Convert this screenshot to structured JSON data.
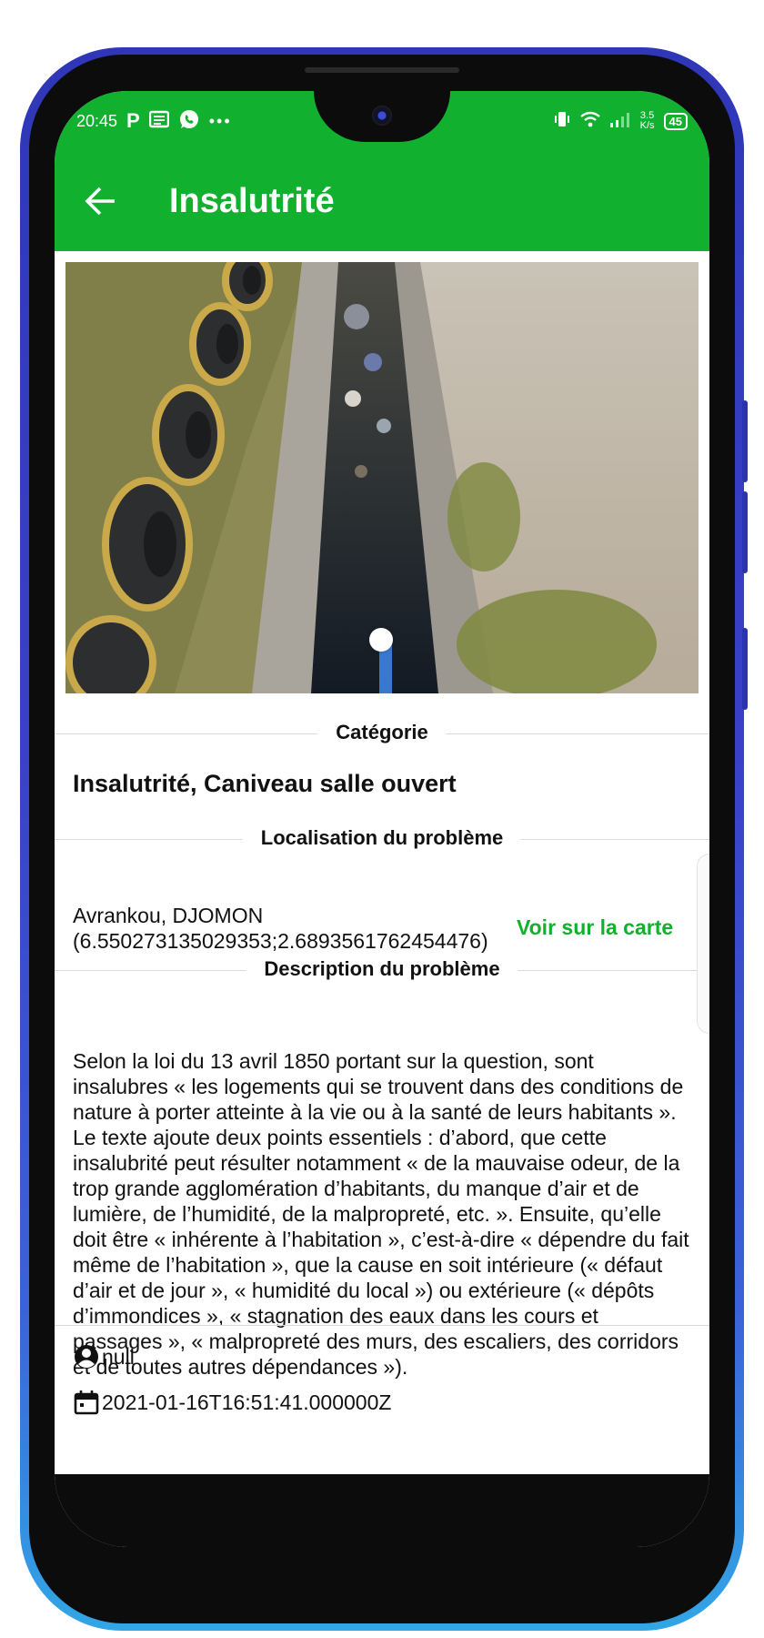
{
  "status_bar": {
    "time": "20:45",
    "app_icons": [
      "P",
      "news-icon",
      "whatsapp-icon"
    ],
    "more": "•••",
    "net_speed_top": "3.5",
    "net_speed_bottom": "K/s",
    "battery": "45"
  },
  "app_bar": {
    "title": "Insalutrité"
  },
  "sections": {
    "category": {
      "header": "Catégorie",
      "value": "Insalutrité, Caniveau salle ouvert"
    },
    "location": {
      "header": "Localisation du problème",
      "address": "Avrankou, DJOMON",
      "coordinates": "(6.550273135029353;2.6893561762454476)",
      "map_link": "Voir sur la carte"
    },
    "description": {
      "header": "Description du problème",
      "text": "Selon la loi du 13 avril 1850 portant sur la question, sont insalubres « les logements qui se trouvent dans des conditions de nature à porter atteinte à la vie ou à la santé de leurs habitants ». Le texte ajoute deux points essentiels : d’abord, que cette insalubrité peut résulter notamment « de la mauvaise odeur, de la trop grande agglomération d’habitants, du manque d’air et de lumière, de l’humidité, de la malpropreté, etc. ». Ensuite, qu’elle doit être « inhérente à l’habitation », c’est-à-dire « dépendre du fait même de l’habitation », que la cause en soit intérieure (« défaut d’air et de jour », « humidité du local ») ou extérieure (« dépôts d’immondices », « stagnation des eaux dans les cours et passages », « malpropreté des murs, des escaliers, des corridors et de toutes autres dépendances »)."
    }
  },
  "meta": {
    "user": "null",
    "date": "2021-01-16T16:51:41.000000Z"
  },
  "colors": {
    "primary": "#12b02f",
    "phone_frame": "#2f37b8"
  }
}
